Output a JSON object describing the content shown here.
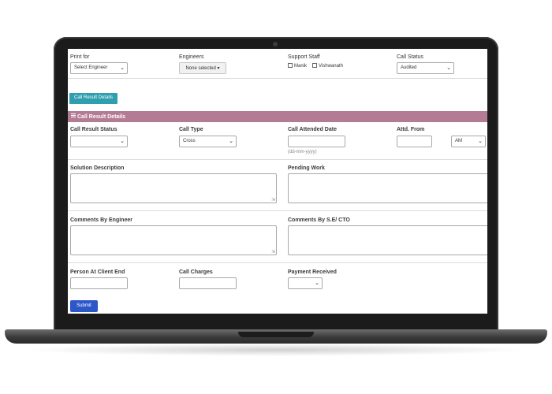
{
  "filters": {
    "print_for": {
      "label": "Print for",
      "value": "Select Engineer"
    },
    "engineers": {
      "label": "Engineers",
      "value": "None selected"
    },
    "support_staff": {
      "label": "Support Staff",
      "options": [
        "Manik",
        "Vishwanath"
      ]
    },
    "call_status": {
      "label": "Call Status",
      "value": "Audited"
    }
  },
  "call_result_button": "Call Result Details",
  "section": {
    "title": "Call Result Details"
  },
  "form": {
    "call_result_status": {
      "label": "Call Result Status",
      "value": ""
    },
    "call_type": {
      "label": "Call Type",
      "value": "Cross"
    },
    "call_attended_date": {
      "label": "Call Attended Date",
      "hint": "(dd-mm-yyyy)"
    },
    "attd_from": {
      "label": "Attd. From",
      "ampm": "AM"
    },
    "solution_description": {
      "label": "Solution Description"
    },
    "pending_work": {
      "label": "Pending Work"
    },
    "comments_by_engineer": {
      "label": "Comments By Engineer"
    },
    "comments_by_se_cto": {
      "label": "Comments By S.E/ CTO"
    },
    "person_at_client_end": {
      "label": "Person At Client End"
    },
    "call_charges": {
      "label": "Call Charges"
    },
    "payment_received": {
      "label": "Payment Received",
      "value": ""
    }
  },
  "submit_label": "Submit"
}
